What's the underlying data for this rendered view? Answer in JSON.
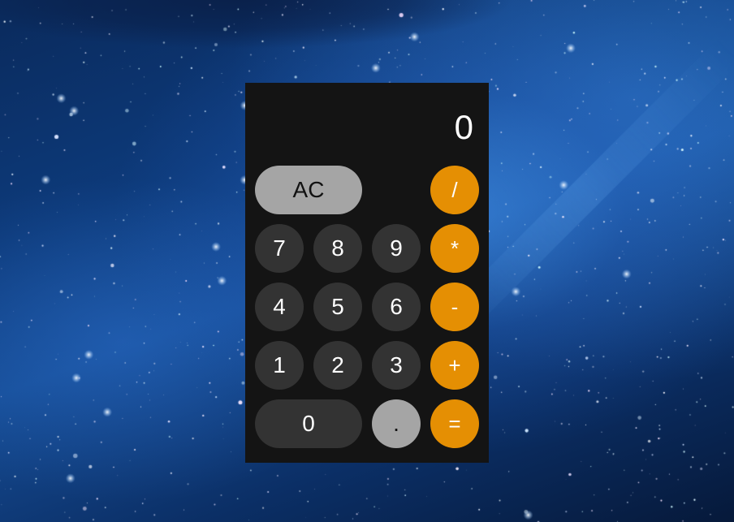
{
  "colors": {
    "calculator_bg": "#141414",
    "number_button": "#333333",
    "function_button": "#a5a5a5",
    "operator_button": "#e58f03"
  },
  "display": {
    "value": "0"
  },
  "buttons": {
    "clear": "AC",
    "divide": "/",
    "seven": "7",
    "eight": "8",
    "nine": "9",
    "multiply": "*",
    "four": "4",
    "five": "5",
    "six": "6",
    "subtract": "-",
    "one": "1",
    "two": "2",
    "three": "3",
    "add": "+",
    "zero": "0",
    "decimal": ".",
    "equals": "="
  }
}
